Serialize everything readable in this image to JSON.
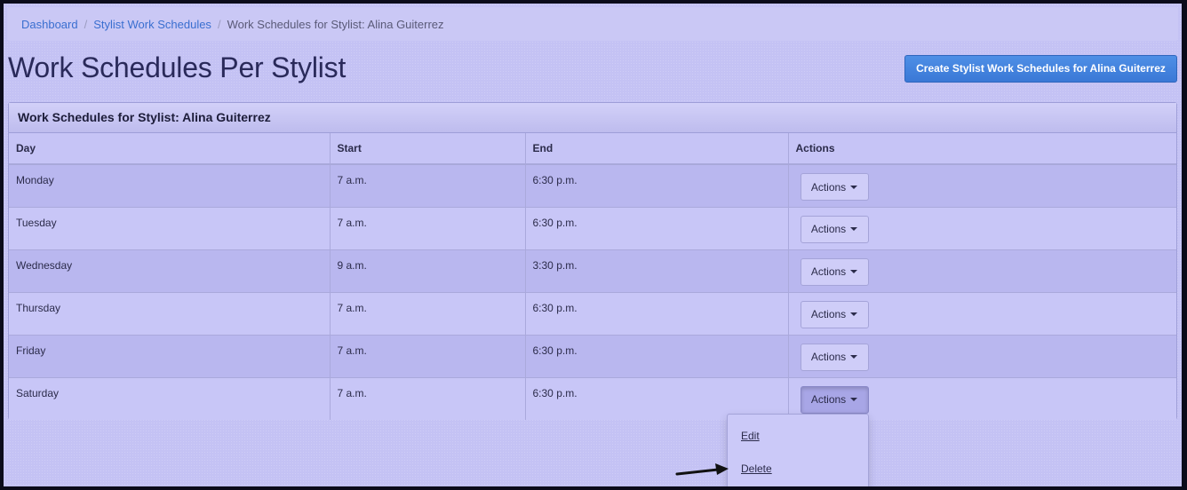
{
  "breadcrumb": {
    "items": [
      "Dashboard",
      "Stylist Work Schedules"
    ],
    "current": "Work Schedules for Stylist: Alina Guiterrez"
  },
  "page": {
    "title": "Work Schedules Per Stylist",
    "create_button": "Create Stylist Work Schedules for Alina Guiterrez"
  },
  "panel": {
    "heading": "Work Schedules for Stylist: Alina Guiterrez",
    "columns": [
      "Day",
      "Start",
      "End",
      "Actions"
    ],
    "rows": [
      {
        "day": "Monday",
        "start": "7 a.m.",
        "end": "6:30 p.m.",
        "action": "Actions"
      },
      {
        "day": "Tuesday",
        "start": "7 a.m.",
        "end": "6:30 p.m.",
        "action": "Actions"
      },
      {
        "day": "Wednesday",
        "start": "9 a.m.",
        "end": "3:30 p.m.",
        "action": "Actions"
      },
      {
        "day": "Thursday",
        "start": "7 a.m.",
        "end": "6:30 p.m.",
        "action": "Actions"
      },
      {
        "day": "Friday",
        "start": "7 a.m.",
        "end": "6:30 p.m.",
        "action": "Actions"
      },
      {
        "day": "Saturday",
        "start": "7 a.m.",
        "end": "6:30 p.m.",
        "action": "Actions"
      }
    ]
  },
  "dropdown": {
    "items": [
      "Edit",
      "Delete"
    ]
  },
  "colors": {
    "page_bg": "#c4c2f4",
    "link": "#3a6fd0",
    "primary_button": "#3a78d6"
  },
  "icons": [
    "caret-down-icon",
    "arrow-right-icon"
  ]
}
